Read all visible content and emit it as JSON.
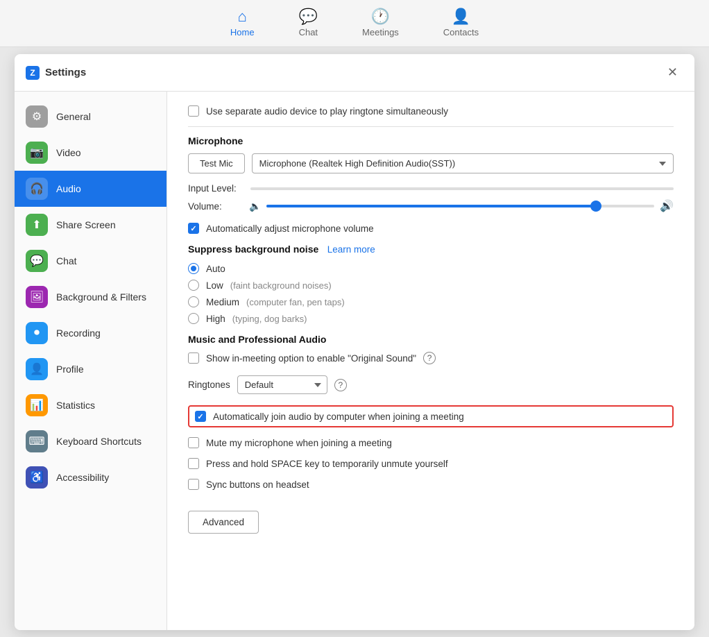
{
  "topnav": {
    "items": [
      {
        "id": "home",
        "label": "Home",
        "icon": "⌂",
        "active": true
      },
      {
        "id": "chat",
        "label": "Chat",
        "icon": "💬",
        "active": false
      },
      {
        "id": "meetings",
        "label": "Meetings",
        "icon": "🕐",
        "active": false
      },
      {
        "id": "contacts",
        "label": "Contacts",
        "icon": "👤",
        "active": false
      }
    ]
  },
  "dialog": {
    "title": "Settings",
    "close_label": "✕"
  },
  "sidebar": {
    "items": [
      {
        "id": "general",
        "label": "General",
        "icon": "⚙"
      },
      {
        "id": "video",
        "label": "Video",
        "icon": "📹"
      },
      {
        "id": "audio",
        "label": "Audio",
        "icon": "🎧",
        "active": true
      },
      {
        "id": "share-screen",
        "label": "Share Screen",
        "icon": "⬆"
      },
      {
        "id": "chat",
        "label": "Chat",
        "icon": "💬"
      },
      {
        "id": "background-filters",
        "label": "Background & Filters",
        "icon": "🖼"
      },
      {
        "id": "recording",
        "label": "Recording",
        "icon": "⏺"
      },
      {
        "id": "profile",
        "label": "Profile",
        "icon": "👤"
      },
      {
        "id": "statistics",
        "label": "Statistics",
        "icon": "📊"
      },
      {
        "id": "keyboard-shortcuts",
        "label": "Keyboard Shortcuts",
        "icon": "⌨"
      },
      {
        "id": "accessibility",
        "label": "Accessibility",
        "icon": "♿"
      }
    ]
  },
  "audio": {
    "separate_device_label": "Use separate audio device to play ringtone simultaneously",
    "microphone_heading": "Microphone",
    "test_mic_label": "Test Mic",
    "device_name": "Microphone (Realtek High Definition Audio(SST))",
    "input_level_label": "Input Level:",
    "volume_label": "Volume:",
    "auto_adjust_label": "Automatically adjust microphone volume",
    "suppress_heading": "Suppress background noise",
    "learn_more_label": "Learn more",
    "noise_options": [
      {
        "id": "auto",
        "label": "Auto",
        "desc": "",
        "selected": true
      },
      {
        "id": "low",
        "label": "Low",
        "desc": "(faint background noises)",
        "selected": false
      },
      {
        "id": "medium",
        "label": "Medium",
        "desc": "(computer fan, pen taps)",
        "selected": false
      },
      {
        "id": "high",
        "label": "High",
        "desc": "(typing, dog barks)",
        "selected": false
      }
    ],
    "music_heading": "Music and Professional Audio",
    "original_sound_label": "Show in-meeting option to enable \"Original Sound\"",
    "ringtones_label": "Ringtones",
    "ringtones_value": "Default",
    "auto_join_label": "Automatically join audio by computer when joining a meeting",
    "mute_mic_label": "Mute my microphone when joining a meeting",
    "press_hold_label": "Press and hold SPACE key to temporarily unmute yourself",
    "sync_buttons_label": "Sync buttons on headset",
    "advanced_label": "Advanced"
  }
}
